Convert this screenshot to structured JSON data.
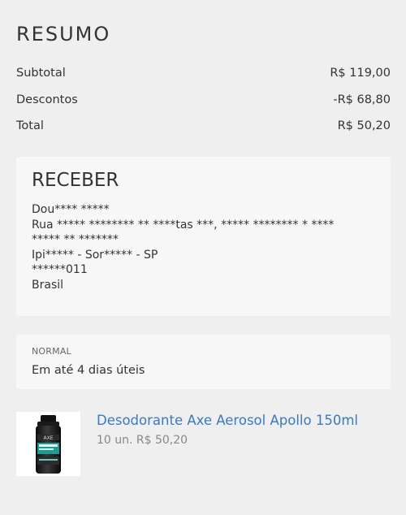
{
  "summary": {
    "title": "RESUMO",
    "rows": [
      {
        "label": "Subtotal",
        "value": "R$ 119,00"
      },
      {
        "label": "Descontos",
        "value": "-R$ 68,80"
      },
      {
        "label": "Total",
        "value": "R$ 50,20"
      }
    ]
  },
  "receive": {
    "title": "RECEBER",
    "lines": [
      "Dou**** *****",
      "Rua ***** ******** ** ****tas ***, ***** ******** * ****",
      "***** ** *******",
      "Ipi***** - Sor***** - SP",
      "******011",
      "Brasil"
    ]
  },
  "shipping": {
    "label": "NORMAL",
    "text": "Em até 4 dias úteis"
  },
  "product": {
    "name": "Desodorante Axe Aerosol Apollo 150ml",
    "meta": "10 un. R$ 50,20",
    "image_icon": "deodorant-can-image",
    "brand_color": "#1f9c91"
  }
}
